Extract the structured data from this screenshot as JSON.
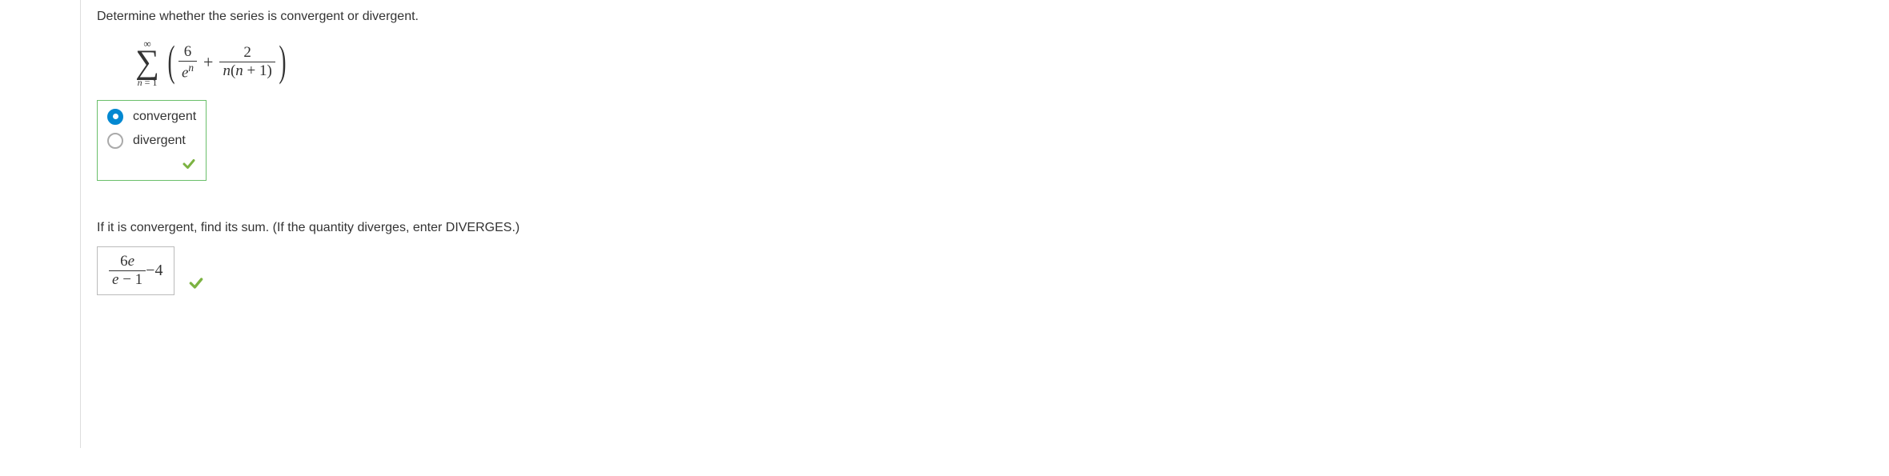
{
  "question": "Determine whether the series is convergent or divergent.",
  "series": {
    "sigma_top": "∞",
    "sigma_bottom_var": "n",
    "sigma_bottom_eq": " = ",
    "sigma_bottom_val": "1",
    "term1_num": "6",
    "term1_den_base": "e",
    "term1_den_exp": "n",
    "plus": "+",
    "term2_num": "2",
    "term2_den": "n(n + 1)"
  },
  "choices": {
    "option1": "convergent",
    "option2": "divergent",
    "selected": "convergent"
  },
  "followup": "If it is convergent, find its sum. (If the quantity diverges, enter DIVERGES.)",
  "answer": {
    "num_coeff": "6",
    "num_var": "e",
    "den_var": "e",
    "den_minus": " − ",
    "den_const": "1",
    "outer_minus": " − ",
    "outer_const": "4"
  }
}
